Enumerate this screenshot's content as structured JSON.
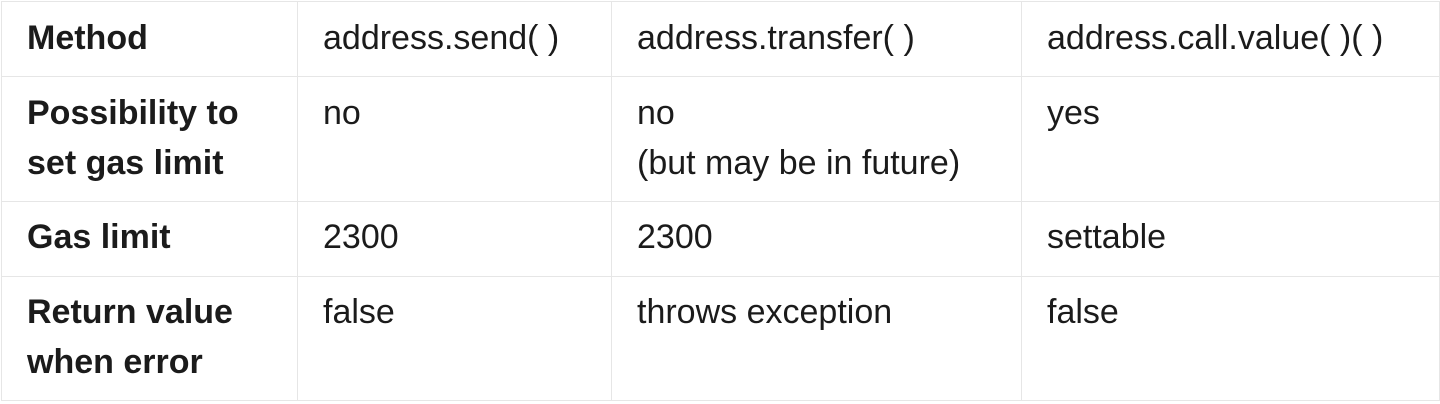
{
  "table": {
    "header": {
      "label": "Method",
      "columns": [
        "address.send( )",
        "address.transfer( )",
        "address.call.value( )( )"
      ]
    },
    "rows": [
      {
        "label": "Possibility to\nset gas limit",
        "cells": [
          "no",
          "no\n(but may be in future)",
          "yes"
        ]
      },
      {
        "label": "Gas limit",
        "cells": [
          "2300",
          "2300",
          "settable"
        ]
      },
      {
        "label": "Return value\nwhen error",
        "cells": [
          "false",
          "throws exception",
          "false"
        ]
      }
    ]
  }
}
